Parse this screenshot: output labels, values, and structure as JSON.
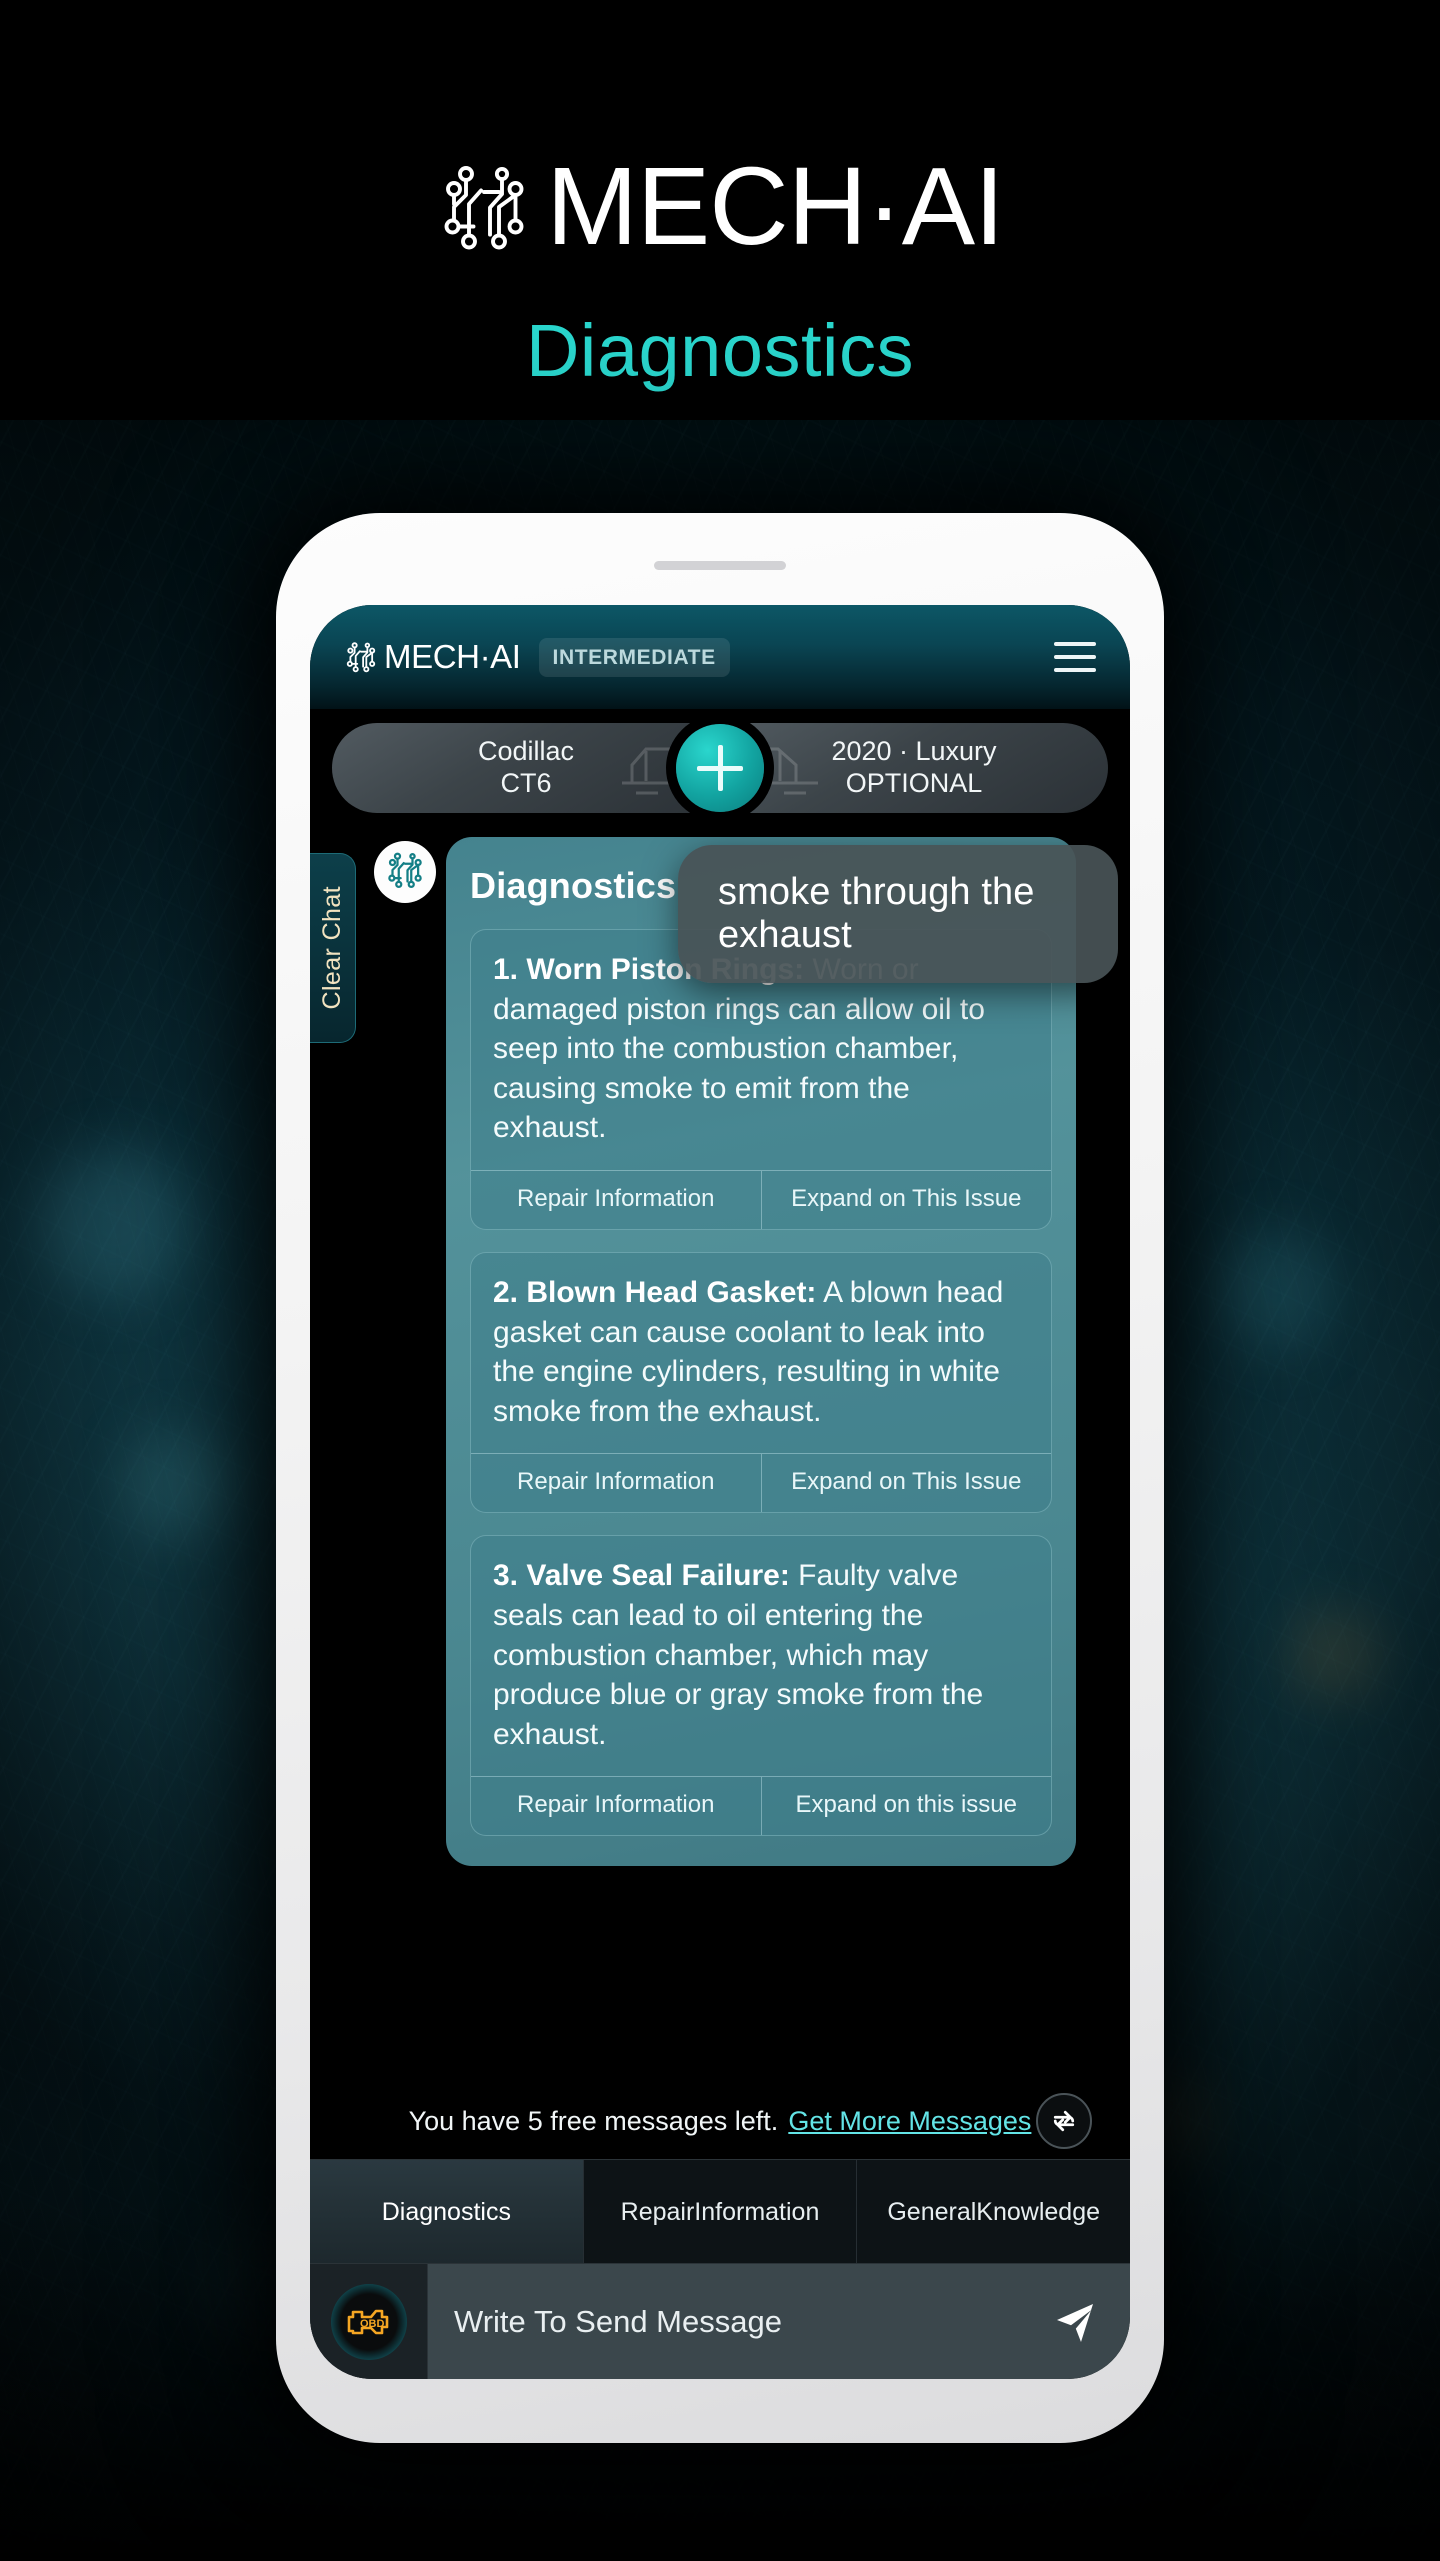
{
  "brand": {
    "name": "MECH·AI",
    "logo_icon": "circuit-logo-icon",
    "page_title": "Diagnostics"
  },
  "app_header": {
    "logo_name": "MECH·AI",
    "level_badge": "INTERMEDIATE",
    "menu_icon": "hamburger-menu-icon"
  },
  "vehicle_selector": {
    "left": {
      "line1": "Codillac",
      "line2": "CT6"
    },
    "add_icon": "plus-icon",
    "right": {
      "line1": "2020 · Luxury",
      "line2": "OPTIONAL"
    }
  },
  "chat": {
    "clear_chat_label": "Clear Chat",
    "avatar_icon": "circuit-logo-icon",
    "message_title": "Diagnostics",
    "tooltip": "smoke through the exhaust",
    "issues": [
      {
        "number": "1.",
        "term": "Worn Piston Rings:",
        "text": " Worn or damaged piston rings can allow oil to seep into the combustion chamber, causing smoke to emit from the exhaust.",
        "btn_left": "Repair Information",
        "btn_right": "Expand on This Issue"
      },
      {
        "number": "2.",
        "term": "Blown Head Gasket:",
        "text": " A blown head gasket can cause coolant to leak into the engine cylinders, resulting in white smoke from the exhaust.",
        "btn_left": "Repair Information",
        "btn_right": "Expand on This Issue"
      },
      {
        "number": "3.",
        "term": "Valve Seal Failure:",
        "text": " Faulty valve seals can lead to oil entering the combustion chamber, which may produce blue or gray smoke from the exhaust.",
        "btn_left": "Repair Information",
        "btn_right": "Expand on this issue"
      }
    ]
  },
  "quota": {
    "text": "You have 5 free messages left.",
    "link": "Get More Messages",
    "refresh_icon": "refresh-icon"
  },
  "mode_tabs": [
    {
      "label": "Diagnostics",
      "active": true
    },
    {
      "label": "Repair\nInformation",
      "active": false
    },
    {
      "label": "General\nKnowledge",
      "active": false
    }
  ],
  "input_bar": {
    "obd_icon": "obd-check-engine-icon",
    "placeholder": "Write To Send Message",
    "send_icon": "send-arrow-icon"
  },
  "colors": {
    "accent_teal": "#2ad6cd",
    "header_teal": "#0c5766",
    "card_teal": "#588f9c",
    "link_cyan": "#63e4e6",
    "badge_text": "#bcd9dd",
    "clear_chat_text": "#f2e3c0",
    "obd_amber": "#f5a623"
  }
}
